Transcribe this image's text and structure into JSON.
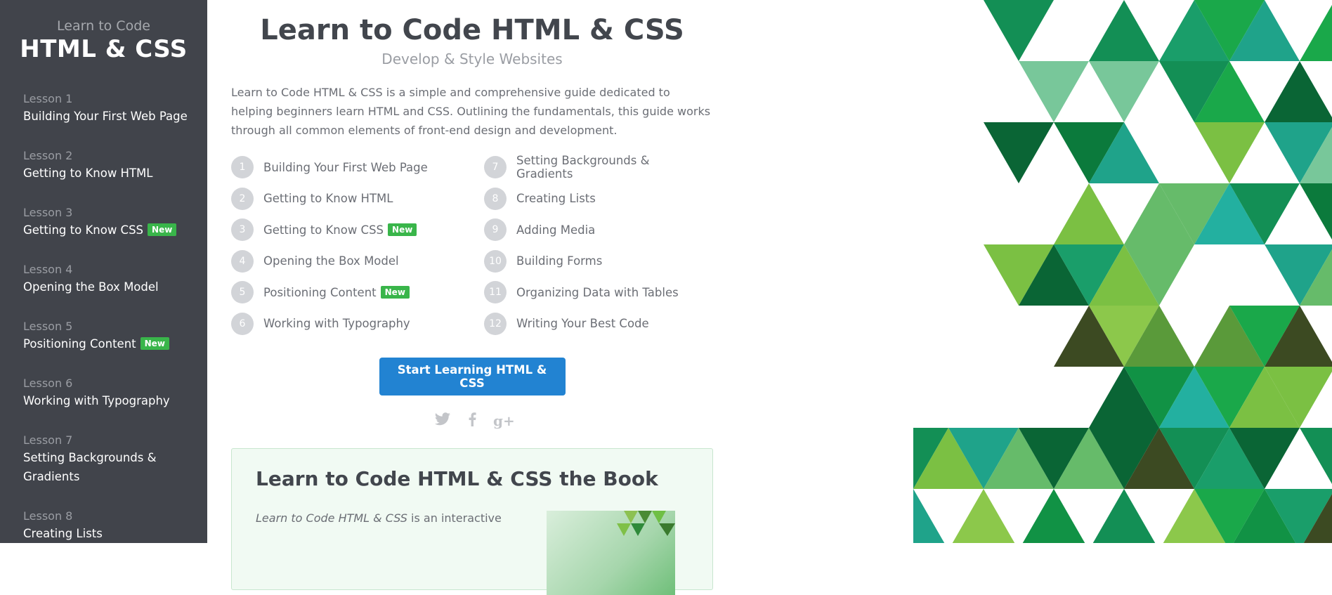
{
  "sidebar": {
    "brand_sub": "Learn to Code",
    "brand_title": "HTML & CSS",
    "lessons": [
      {
        "num": "Lesson 1",
        "title": "Building Your First Web Page"
      },
      {
        "num": "Lesson 2",
        "title": "Getting to Know HTML"
      },
      {
        "num": "Lesson 3",
        "title": "Getting to Know CSS",
        "badge": "New"
      },
      {
        "num": "Lesson 4",
        "title": "Opening the Box Model"
      },
      {
        "num": "Lesson 5",
        "title": "Positioning Content",
        "badge": "New"
      },
      {
        "num": "Lesson 6",
        "title": "Working with Typography"
      },
      {
        "num": "Lesson 7",
        "title": "Setting Backgrounds & Gradients"
      },
      {
        "num": "Lesson 8",
        "title": "Creating Lists"
      }
    ]
  },
  "main": {
    "title": "Learn to Code HTML & CSS",
    "subtitle": "Develop & Style Websites",
    "intro": "Learn to Code HTML & CSS is a simple and comprehensive guide dedicated to helping beginners learn HTML and CSS. Outlining the fundamentals, this guide works through all common elements of front-end design and development.",
    "outline_left": [
      {
        "n": "1",
        "label": "Building Your First Web Page"
      },
      {
        "n": "2",
        "label": "Getting to Know HTML"
      },
      {
        "n": "3",
        "label": "Getting to Know CSS",
        "badge": "New"
      },
      {
        "n": "4",
        "label": "Opening the Box Model"
      },
      {
        "n": "5",
        "label": "Positioning Content",
        "badge": "New"
      },
      {
        "n": "6",
        "label": "Working with Typography"
      }
    ],
    "outline_right": [
      {
        "n": "7",
        "label": "Setting Backgrounds & Gradients"
      },
      {
        "n": "8",
        "label": "Creating Lists"
      },
      {
        "n": "9",
        "label": "Adding Media"
      },
      {
        "n": "10",
        "label": "Building Forms"
      },
      {
        "n": "11",
        "label": "Organizing Data with Tables"
      },
      {
        "n": "12",
        "label": "Writing Your Best Code"
      }
    ],
    "cta_label": "Start Learning HTML & CSS",
    "social": {
      "twitter": "twitter-icon",
      "facebook": "facebook-icon",
      "gplus": "google-plus-icon"
    },
    "book": {
      "title": "Learn to Code HTML & CSS the Book",
      "text_italic": "Learn to Code HTML & CSS",
      "text_rest": " is an interactive"
    }
  },
  "colors": {
    "sidebar_bg": "#41444b",
    "accent_blue": "#2283d2",
    "badge_green": "#39b54a",
    "book_bg": "#f1faf3"
  }
}
